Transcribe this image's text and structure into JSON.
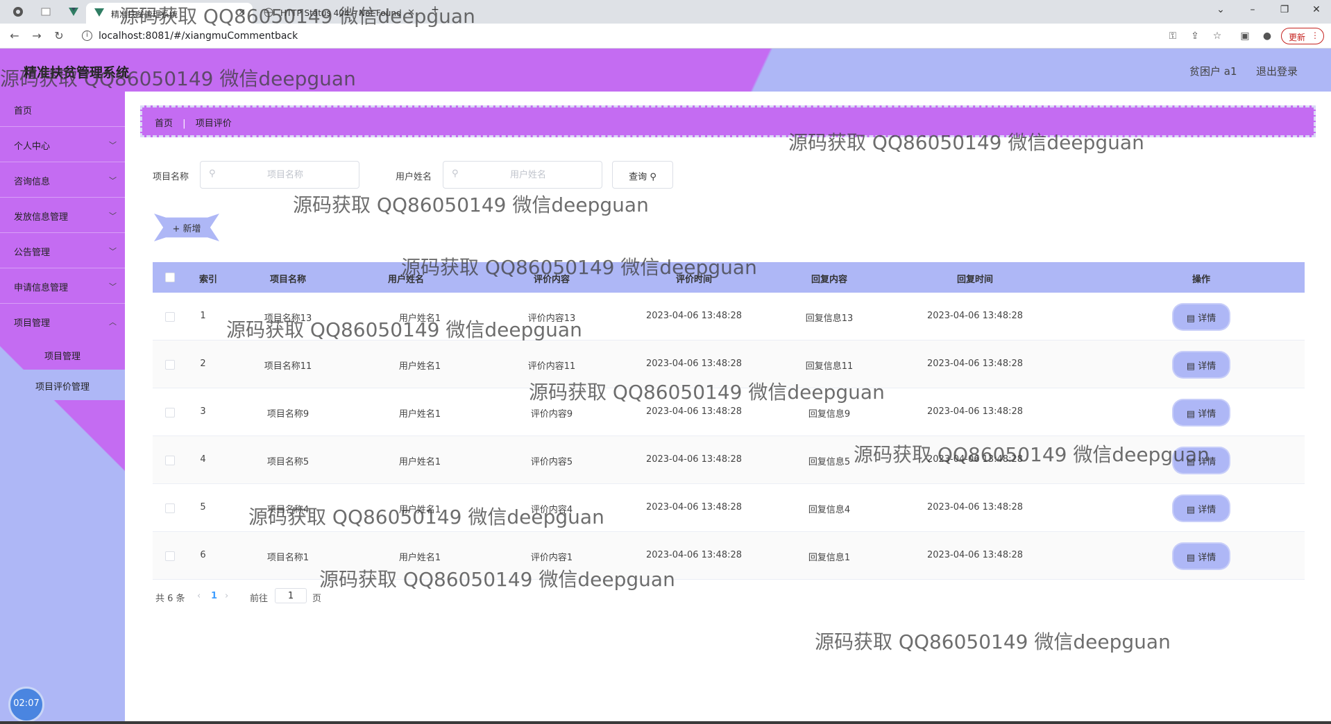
{
  "browser": {
    "tabs": [
      {
        "title": "精准扶贫管理系统",
        "active": true
      },
      {
        "title": "HTTP Status 404 – Not Found",
        "active": false
      }
    ],
    "url": "localhost:8081/#/xiangmuCommentback",
    "update_label": "更新"
  },
  "header": {
    "app_title": "精准扶贫管理系统",
    "user_label": "贫困户 a1",
    "logout_label": "退出登录"
  },
  "sidebar": {
    "items": [
      {
        "label": "首页",
        "has_arrow": false
      },
      {
        "label": "个人中心",
        "has_arrow": true
      },
      {
        "label": "咨询信息",
        "has_arrow": true
      },
      {
        "label": "发放信息管理",
        "has_arrow": true
      },
      {
        "label": "公告管理",
        "has_arrow": true
      },
      {
        "label": "申请信息管理",
        "has_arrow": true
      },
      {
        "label": "项目管理",
        "has_arrow": true
      }
    ],
    "sub_items": [
      {
        "label": "项目管理",
        "active": false
      },
      {
        "label": "项目评价管理",
        "active": true
      }
    ],
    "clock": "02:07"
  },
  "breadcrumb": {
    "home": "首页",
    "current": "项目评价"
  },
  "search": {
    "project_label": "项目名称",
    "project_placeholder": "项目名称",
    "user_label": "用户姓名",
    "user_placeholder": "用户姓名",
    "query_label": "查询"
  },
  "add_label": "新增",
  "table": {
    "headers": [
      "索引",
      "项目名称",
      "用户姓名",
      "评价内容",
      "评价时间",
      "回复内容",
      "回复时间",
      "操作"
    ],
    "rows": [
      [
        "1",
        "项目名称13",
        "用户姓名1",
        "评价内容13",
        "2023-04-06 13:48:28",
        "回复信息13",
        "2023-04-06 13:48:28"
      ],
      [
        "2",
        "项目名称11",
        "用户姓名1",
        "评价内容11",
        "2023-04-06 13:48:28",
        "回复信息11",
        "2023-04-06 13:48:28"
      ],
      [
        "3",
        "项目名称9",
        "用户姓名1",
        "评价内容9",
        "2023-04-06 13:48:28",
        "回复信息9",
        "2023-04-06 13:48:28"
      ],
      [
        "4",
        "项目名称5",
        "用户姓名1",
        "评价内容5",
        "2023-04-06 13:48:28",
        "回复信息5",
        "2023-04-06 13:48:28"
      ],
      [
        "5",
        "项目名称4",
        "用户姓名1",
        "评价内容4",
        "2023-04-06 13:48:28",
        "回复信息4",
        "2023-04-06 13:48:28"
      ],
      [
        "6",
        "项目名称1",
        "用户姓名1",
        "评价内容1",
        "2023-04-06 13:48:28",
        "回复信息1",
        "2023-04-06 13:48:28"
      ]
    ],
    "detail_label": "详情"
  },
  "pagination": {
    "total": "共 6 条",
    "current_page": "1",
    "goto_label": "前往",
    "goto_value": "1",
    "page_suffix": "页"
  },
  "watermark": "源码获取 QQ86050149 微信deepguan",
  "colors": {
    "purple": "#c46cf2",
    "lavender": "#aeb7f6"
  }
}
